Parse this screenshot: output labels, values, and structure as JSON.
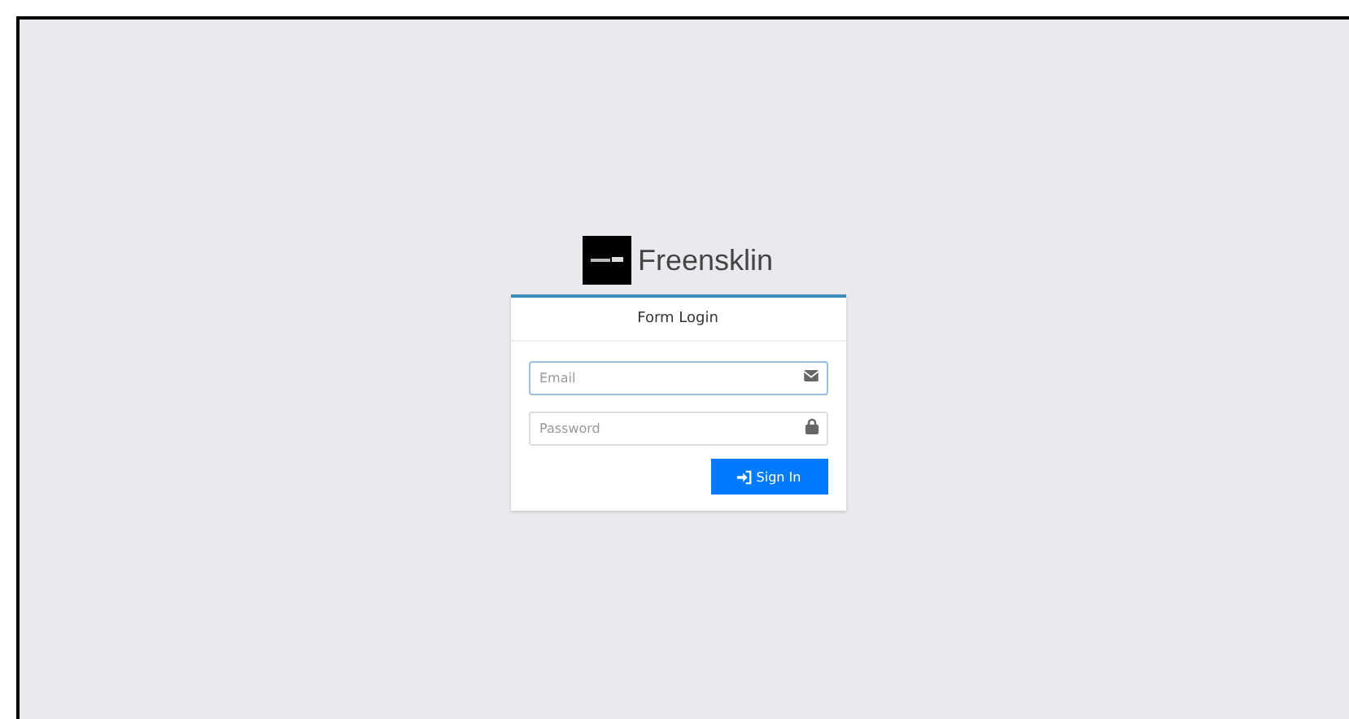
{
  "brand": {
    "name": "Freensklin"
  },
  "card": {
    "title": "Form Login"
  },
  "fields": [
    {
      "placeholder": "Email",
      "kind": "email",
      "focused": true
    },
    {
      "placeholder": "Password",
      "kind": "password",
      "focused": false
    }
  ],
  "submit": {
    "label": "Sign In"
  }
}
